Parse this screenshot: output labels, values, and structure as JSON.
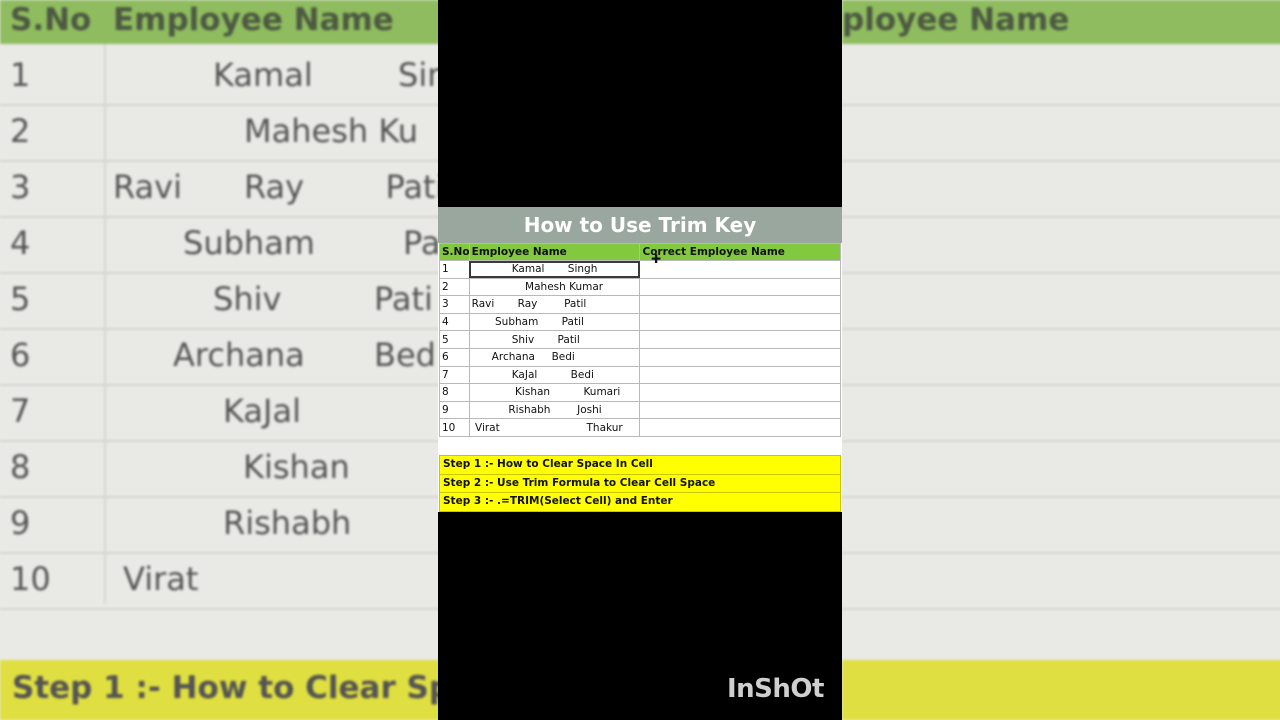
{
  "title": "How to Use Trim Key",
  "headers": [
    "S.No",
    "Employee Name",
    "Correct Employee Name"
  ],
  "rows": [
    {
      "sno": "1",
      "name": "            Kamal       Singh"
    },
    {
      "sno": "2",
      "name": "                Mahesh Kumar"
    },
    {
      "sno": "3",
      "name": "Ravi       Ray        Patil"
    },
    {
      "sno": "4",
      "name": "       Subham       Patil"
    },
    {
      "sno": "5",
      "name": "            Shiv       Patil"
    },
    {
      "sno": "6",
      "name": "      Archana     Bedi"
    },
    {
      "sno": "7",
      "name": "            KaJal          Bedi"
    },
    {
      "sno": "8",
      "name": "             Kishan          Kumari"
    },
    {
      "sno": "9",
      "name": "           Rishabh        Joshi"
    },
    {
      "sno": "10",
      "name": " Virat                          Thakur"
    }
  ],
  "steps": [
    "Step 1 :- How to Clear Space In Cell",
    "Step 2 :- Use Trim Formula to Clear Cell Space",
    "Step 3 :- .=TRIM(Select Cell) and Enter"
  ],
  "watermark": "InShOt",
  "background": {
    "headers": [
      "S.No",
      "Employee Name",
      "ployee Name"
    ],
    "rows": [
      {
        "sno": "1",
        "name": "Kamal",
        "extra": "Sin"
      },
      {
        "sno": "2",
        "name": "Mahesh Ku",
        "extra": ""
      },
      {
        "sno": "3",
        "name": "Ravi",
        "extra": "Ray        Pati"
      },
      {
        "sno": "4",
        "name": "Subham",
        "extra": "Pa"
      },
      {
        "sno": "5",
        "name": "Shiv",
        "extra": "Pati"
      },
      {
        "sno": "6",
        "name": "Archana",
        "extra": "Bed"
      },
      {
        "sno": "7",
        "name": "KaJal",
        "extra": ""
      },
      {
        "sno": "8",
        "name": "Kishan",
        "extra": ""
      },
      {
        "sno": "9",
        "name": "Rishabh",
        "extra": ""
      },
      {
        "sno": "10",
        "name": "Virat",
        "extra": ""
      }
    ],
    "step": "Step 1 :- How to Clear Sp"
  },
  "colors": {
    "header_green": "#82c93f",
    "step_yellow": "#ffff00",
    "title_bar": "#9aa79e"
  }
}
